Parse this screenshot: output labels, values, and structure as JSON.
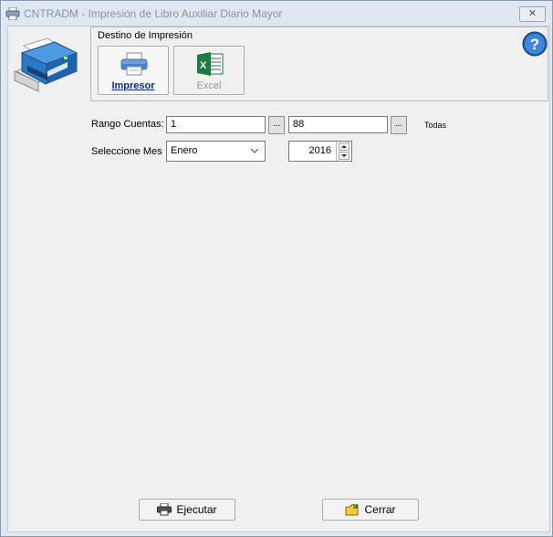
{
  "window": {
    "title": "CNTRADM - Impresión de Libro Auxiliar Diario Mayor",
    "close_label": "✕"
  },
  "destino": {
    "label": "Destino de Impresión",
    "impresor_label": "Impresor",
    "excel_label": "Excel"
  },
  "form": {
    "rango_label": "Rango Cuentas:",
    "rango_desde": "1",
    "rango_hasta": "88",
    "ellipsis": "...",
    "todas_label": "Todas",
    "mes_label": "Seleccione Mes",
    "mes_value": "Enero",
    "year_value": "2016"
  },
  "actions": {
    "ejecutar_label": "Ejecutar",
    "cerrar_label": "Cerrar"
  },
  "colors": {
    "accent": "#0b2a9e",
    "help": "#1f5fb0",
    "excel": "#1d7a45"
  }
}
